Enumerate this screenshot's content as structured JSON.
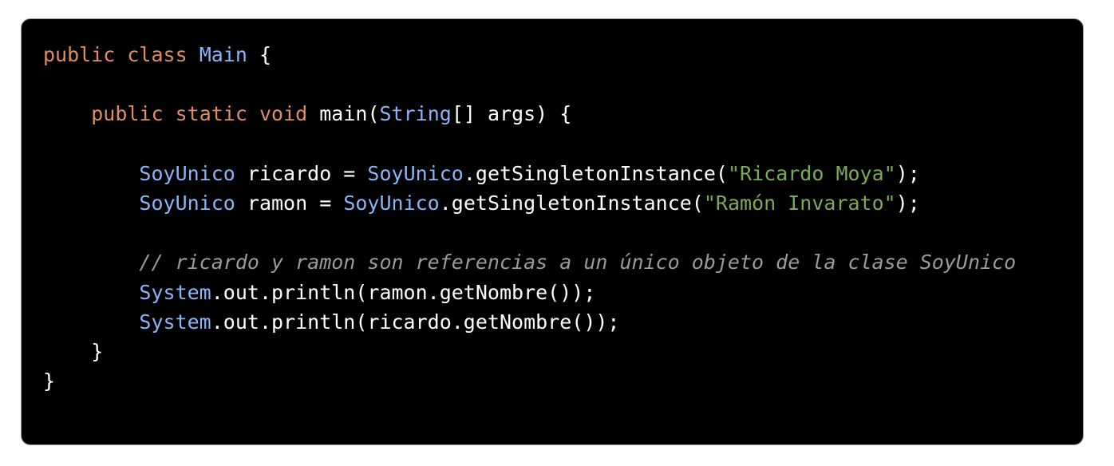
{
  "colors": {
    "background": "#000000",
    "border": "#9a9a9a",
    "keyword": "#e08c63",
    "type": "#8ab4f8",
    "string": "#78ab58",
    "comment": "#9b9b9b",
    "plain": "#ffffff"
  },
  "code": {
    "language": "java",
    "lines": [
      [
        {
          "text": "public",
          "style": "kw"
        },
        {
          "text": " ",
          "style": "plain"
        },
        {
          "text": "class",
          "style": "kw"
        },
        {
          "text": " ",
          "style": "plain"
        },
        {
          "text": "Main",
          "style": "type"
        },
        {
          "text": " {",
          "style": "plain"
        }
      ],
      [],
      [
        {
          "text": "    ",
          "style": "plain"
        },
        {
          "text": "public",
          "style": "kw"
        },
        {
          "text": " ",
          "style": "plain"
        },
        {
          "text": "static",
          "style": "kw"
        },
        {
          "text": " ",
          "style": "plain"
        },
        {
          "text": "void",
          "style": "kw"
        },
        {
          "text": " main(",
          "style": "plain"
        },
        {
          "text": "String",
          "style": "type"
        },
        {
          "text": "[] args) {",
          "style": "plain"
        }
      ],
      [],
      [
        {
          "text": "        ",
          "style": "plain"
        },
        {
          "text": "SoyUnico",
          "style": "type"
        },
        {
          "text": " ricardo = ",
          "style": "plain"
        },
        {
          "text": "SoyUnico",
          "style": "type"
        },
        {
          "text": ".getSingletonInstance(",
          "style": "plain"
        },
        {
          "text": "\"Ricardo Moya\"",
          "style": "str"
        },
        {
          "text": ");",
          "style": "plain"
        }
      ],
      [
        {
          "text": "        ",
          "style": "plain"
        },
        {
          "text": "SoyUnico",
          "style": "type"
        },
        {
          "text": " ramon = ",
          "style": "plain"
        },
        {
          "text": "SoyUnico",
          "style": "type"
        },
        {
          "text": ".getSingletonInstance(",
          "style": "plain"
        },
        {
          "text": "\"Ramón Invarato\"",
          "style": "str"
        },
        {
          "text": ");",
          "style": "plain"
        }
      ],
      [],
      [
        {
          "text": "        ",
          "style": "plain"
        },
        {
          "text": "// ricardo y ramon son referencias a un único objeto de la clase SoyUnico",
          "style": "cmt"
        }
      ],
      [
        {
          "text": "        ",
          "style": "plain"
        },
        {
          "text": "System",
          "style": "type"
        },
        {
          "text": ".out.println(ramon.getNombre());",
          "style": "plain"
        }
      ],
      [
        {
          "text": "        ",
          "style": "plain"
        },
        {
          "text": "System",
          "style": "type"
        },
        {
          "text": ".out.println(ricardo.getNombre());",
          "style": "plain"
        }
      ],
      [
        {
          "text": "    }",
          "style": "plain"
        }
      ],
      [
        {
          "text": "}",
          "style": "plain"
        }
      ]
    ]
  }
}
